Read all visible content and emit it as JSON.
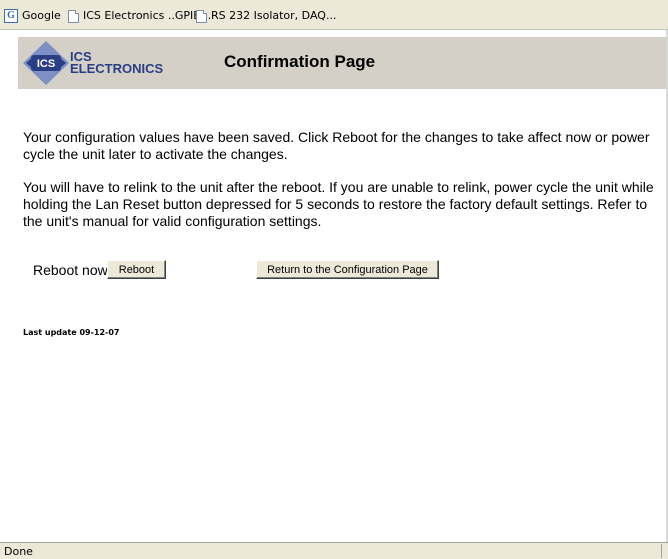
{
  "bookmarks": [
    {
      "icon": "google-icon",
      "label": "Google"
    },
    {
      "icon": "page-icon",
      "label": "ICS Electronics ..GPIB..."
    },
    {
      "icon": "page-icon",
      "label": "RS 232 Isolator, DAQ..."
    }
  ],
  "header": {
    "logo_abbrev": "ICS",
    "logo_line1": "ICS",
    "logo_line2": "ELECTRONICS",
    "title": "Confirmation Page"
  },
  "content": {
    "paragraph1": "Your configuration values have been saved. Click Reboot for the changes to take affect now or power cycle the unit later to activate the changes.",
    "paragraph2": "You will have to relink to the unit after the reboot. If you are unable to relink, power cycle the unit while holding the Lan Reset button depressed for 5 seconds to restore the factory default settings. Refer to the unit's manual for valid configuration settings."
  },
  "actions": {
    "reboot_label": "Reboot now",
    "reboot_button": "Reboot",
    "return_button": "Return to the Configuration Page"
  },
  "footer": {
    "last_update": "Last update 09-12-07"
  },
  "status": {
    "text": "Done"
  },
  "colors": {
    "header_bg": "#d4d0c8",
    "logo_blue": "#2a3e86",
    "logo_diamond": "#7d8fc4"
  }
}
